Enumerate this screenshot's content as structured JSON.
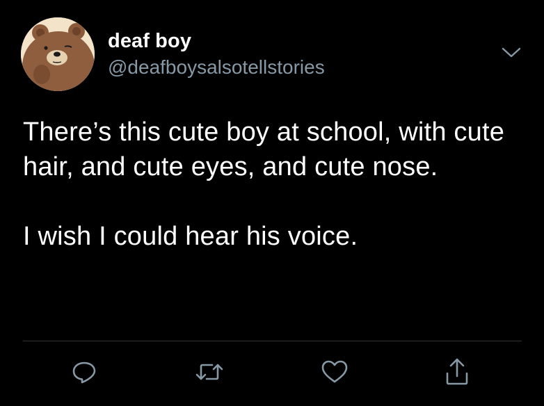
{
  "user": {
    "display_name": "deaf boy",
    "handle": "@deafboysalsotellstories",
    "avatar_icon": "bear-avatar"
  },
  "tweet": {
    "paragraphs": [
      "There’s this cute boy at school, with cute hair, and cute eyes, and cute nose.",
      "I wish I could hear his voice."
    ]
  },
  "menu": {
    "icon": "chevron-down-icon"
  },
  "actions": [
    {
      "name": "reply",
      "icon": "reply-icon"
    },
    {
      "name": "retweet",
      "icon": "retweet-icon"
    },
    {
      "name": "like",
      "icon": "heart-icon"
    },
    {
      "name": "share",
      "icon": "share-icon"
    }
  ],
  "colors": {
    "background": "#000000",
    "text_primary": "#ffffff",
    "text_secondary": "#8899a6",
    "divider": "#2f3336",
    "icon": "#8899a6"
  }
}
